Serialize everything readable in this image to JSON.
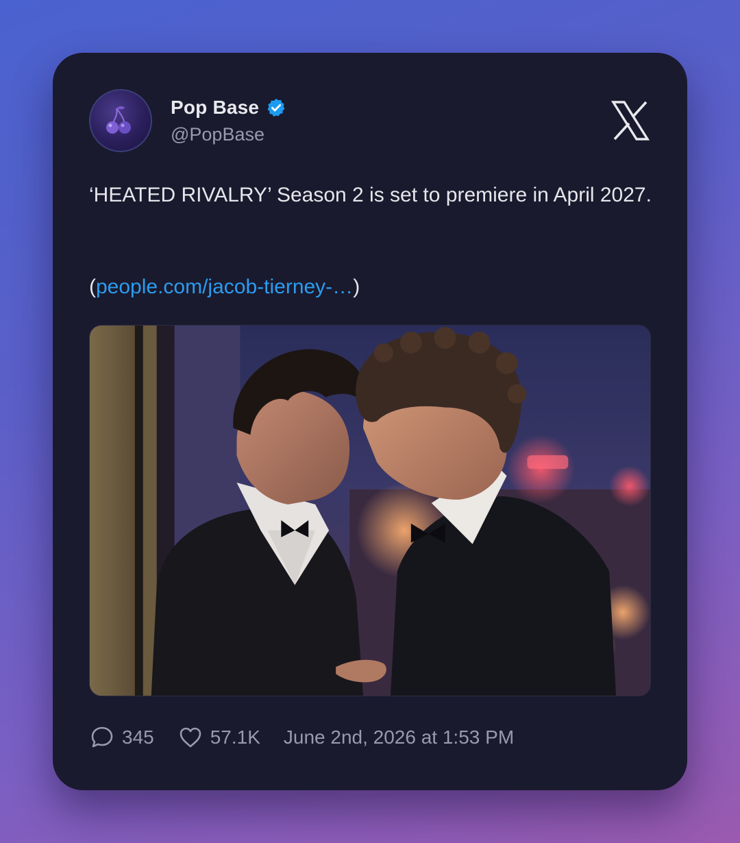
{
  "tweet": {
    "author": {
      "display_name": "Pop Base",
      "handle": "@PopBase",
      "verified": true,
      "avatar_icon": "cherry-icon"
    },
    "platform_icon": "x-logo-icon",
    "text": "‘HEATED RIVALRY’ Season 2 is set to premiere in April 2027.",
    "link_open": "(",
    "link_text": "people.com/jacob-tierney-…",
    "link_close": ")",
    "media_description_icon": "photo-image",
    "stats": {
      "replies": "345",
      "likes": "57.1K"
    },
    "timestamp": "June 2nd, 2026 at 1:53 PM"
  },
  "colors": {
    "card_background": "#1a1a2e",
    "link": "#2b9cf0",
    "verified_badge": "#1d9bf0",
    "muted_text": "#9a9aab",
    "primary_text": "#e6e6ec"
  }
}
